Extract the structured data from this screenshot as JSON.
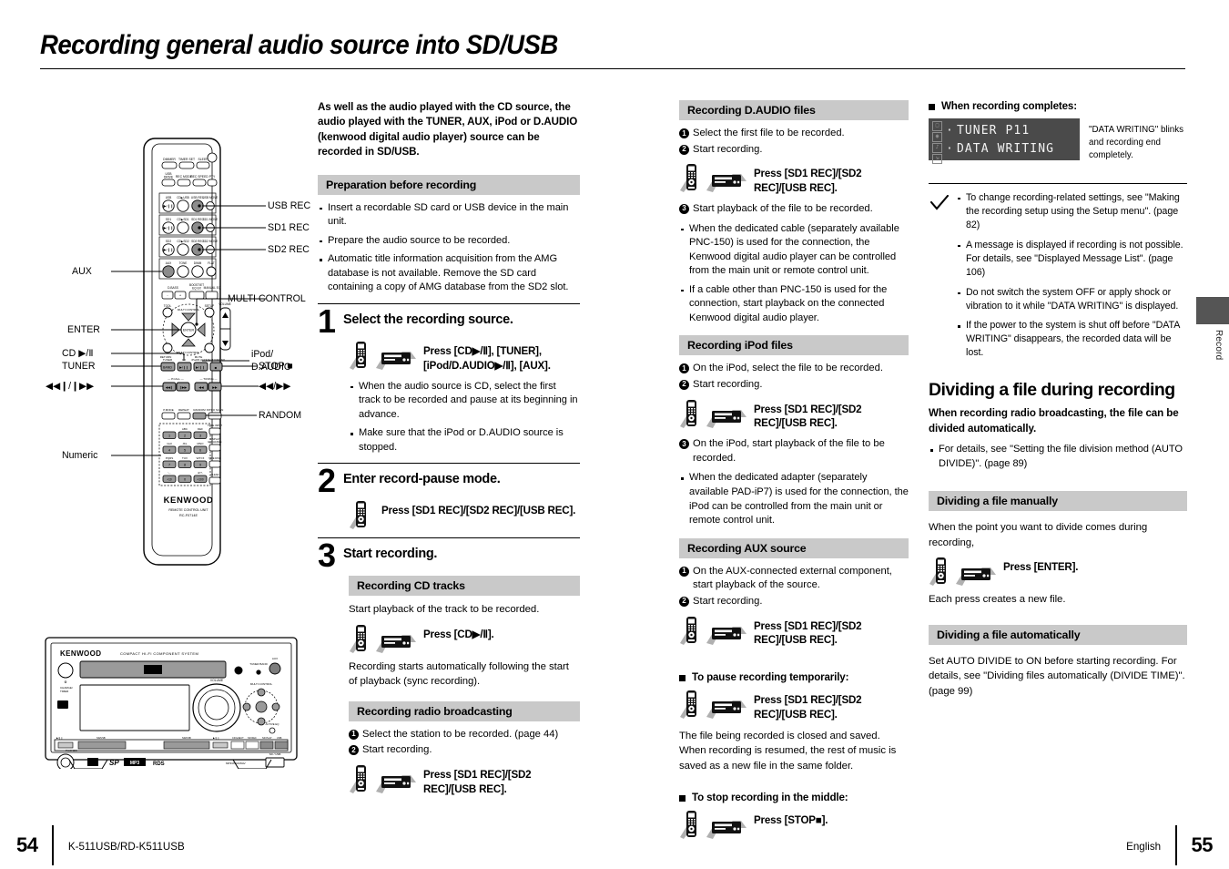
{
  "document": {
    "title": "Recording general audio source into SD/USB",
    "side_tab": "Record",
    "footer": {
      "page_left": "54",
      "model": "K-511USB/RD-K511USB",
      "language": "English",
      "page_right": "55"
    }
  },
  "diagram": {
    "remote_callouts": [
      {
        "label": "USB REC"
      },
      {
        "label": "SD1 REC"
      },
      {
        "label": "SD2 REC"
      },
      {
        "label": "AUX"
      },
      {
        "label": "MULTI CONTROL"
      },
      {
        "label": "ENTER"
      },
      {
        "label": "CD ▶/Ⅱ"
      },
      {
        "label": "TUNER"
      },
      {
        "label": "◀◀/▶▶"
      },
      {
        "label": "iPod/"
      },
      {
        "label": "D.AUDIO"
      },
      {
        "label": "STOP ■"
      },
      {
        "label": "RANDOM"
      },
      {
        "label": "Numeric"
      },
      {
        "label": "◀◀/▶▶"
      }
    ],
    "remote_brand": "KENWOOD",
    "remote_sub1": "REMOTE CONTROL UNIT",
    "remote_sub2": "RC-F0714E",
    "remote_top_row1": [
      "DIMMER",
      "TIMER SET",
      "SLEEP"
    ],
    "remote_top_row2": [
      "USB DRIVE",
      "REC MODE",
      "REC SPEED",
      "PTY"
    ],
    "remote_bank_labels": [
      [
        "USB",
        "CD▶USB",
        "USB REC",
        "USB MOVE"
      ],
      [
        "SD1",
        "CD▶SD1",
        "SD1 REC",
        "SD1 MOVE"
      ],
      [
        "SD2",
        "CD▶SD2",
        "SD2 REC",
        "SD2 MOVE"
      ],
      [
        "AUX",
        "TONE",
        "DIMM",
        "FLAT"
      ]
    ],
    "remote_bass_row": [
      "D-BASS",
      "-",
      "+",
      "BOOST/ET EQ EX",
      "MANUAL EQ"
    ],
    "remote_mid_labels": [
      "TOOL",
      "SETUP",
      "VOLUME",
      "MULTI CONTROL",
      "ENTER"
    ],
    "remote_transport_labels": [
      "RETURN",
      "TUNER",
      "CD",
      "MUTE",
      "iPod/D.AUDIO",
      "AUTO/MONO",
      "P.CALL",
      "TUNING"
    ],
    "remote_mode_labels": [
      "P.MODE",
      "REPEAT",
      "RANDOM",
      "INTRO SCAN"
    ],
    "remote_numeric": [
      "1",
      "2",
      "3",
      "4",
      "5",
      "6",
      "7",
      "8",
      "9",
      "+10",
      "0",
      "+100"
    ],
    "remote_numeric_alpha": [
      "",
      "ABC",
      "DEF",
      "GHI",
      "JKL",
      "MNO",
      "PQRS",
      "TUV",
      "WXYZ",
      "'-,.",
      "",
      "&!?-"
    ],
    "remote_side_labels": [
      "TITLE INPUT",
      "DISPLAY EXCHANGE",
      "TIME DISP.",
      "CLEAR"
    ],
    "unit_brand": "KENWOOD",
    "unit_subtitle": "COMPACT HI-FI COMPONENT SYSTEM",
    "unit_badges": [
      "SD",
      "SP",
      "MP3",
      "RDS"
    ]
  },
  "col2": {
    "lead": "As well as the audio played with the CD source, the audio played with the TUNER, AUX, iPod or D.AUDIO (kenwood digital audio player) source can be recorded in SD/USB.",
    "prep_heading": "Preparation before recording",
    "prep_bullets": [
      "Insert a recordable SD card or USB device in the main unit.",
      "Prepare the audio source to be recorded.",
      "Automatic title information acquisition from the AMG database is not available. Remove the SD card containing a copy of AMG database from the SD2 slot."
    ],
    "step1": {
      "num": "1",
      "title": "Select the recording source.",
      "press": "Press [CD▶/Ⅱ], [TUNER], [iPod/D.AUDIO▶/Ⅱ], [AUX].",
      "bullets": [
        "When the audio source is CD, select the first track to be recorded and pause at its beginning in advance.",
        "Make sure that the iPod or D.AUDIO source is stopped."
      ]
    },
    "step2": {
      "num": "2",
      "title": "Enter record-pause mode.",
      "press": "Press [SD1 REC]/[SD2 REC]/[USB REC]."
    },
    "step3": {
      "num": "3",
      "title": "Start recording.",
      "cd_heading": "Recording CD tracks",
      "cd_intro": "Start playback of the track to be recorded.",
      "cd_press": "Press [CD▶/Ⅱ].",
      "cd_note": "Recording starts automatically following the start of playback (sync recording).",
      "radio_heading": "Recording radio broadcasting",
      "radio_steps": [
        "Select the station to be recorded. (page 44)",
        "Start recording."
      ],
      "radio_press": "Press [SD1 REC]/[SD2 REC]/[USB REC]."
    }
  },
  "col3": {
    "daudio": {
      "heading": "Recording D.AUDIO files",
      "steps_before": [
        "Select the first file to be recorded.",
        "Start recording."
      ],
      "press": "Press [SD1 REC]/[SD2 REC]/[USB REC].",
      "step_after": "Start playback of the file to be recorded.",
      "bullets": [
        "When the dedicated cable (separately available PNC-150) is used for the connection, the Kenwood digital audio player can be controlled from the main unit or remote control unit.",
        "If a cable other than PNC-150 is used for the connection, start playback on the connected Kenwood digital audio player."
      ]
    },
    "ipod": {
      "heading": "Recording iPod files",
      "steps_before": [
        "On the iPod, select the file to be recorded.",
        "Start recording."
      ],
      "press": "Press [SD1 REC]/[SD2 REC]/[USB REC].",
      "step_after": "On the iPod, start playback of the file to be recorded.",
      "bullets": [
        "When the dedicated adapter (separately available PAD-iP7) is used for the connection, the iPod can be controlled from the main unit or remote control unit."
      ]
    },
    "aux": {
      "heading": "Recording AUX source",
      "steps": [
        "On the AUX-connected external component, start playback of the source.",
        "Start recording."
      ],
      "press": "Press [SD1 REC]/[SD2 REC]/[USB REC]."
    },
    "pause": {
      "heading": "To pause recording temporarily:",
      "press": "Press [SD1 REC]/[SD2 REC]/[USB REC].",
      "note": "The file being recorded is closed and saved. When recording is resumed, the rest of music is saved as a new file in the same folder."
    },
    "stop": {
      "heading": "To stop recording in the middle:",
      "press": "Press [STOP■]."
    }
  },
  "col4": {
    "complete": {
      "heading": "When recording completes:",
      "lcd_line1": "TUNER P11",
      "lcd_line2": "DATA WRITING",
      "note": "\"DATA WRITING\" blinks and recording end completely."
    },
    "notes": [
      "To change recording-related settings, see \"Making the recording setup using the Setup menu\". (page 82)",
      "A message is displayed if recording is not possible. For details, see \"Displayed Message List\". (page 106)",
      "Do not switch the system OFF or apply shock or vibration to it while \"DATA WRITING\" is displayed.",
      "If the power to the system is shut off before \"DATA WRITING\" disappears, the recorded data will be lost."
    ],
    "divide": {
      "heading": "Dividing a file during recording",
      "lead": "When recording radio broadcasting, the file can be divided automatically.",
      "bullets": [
        "For details, see \"Setting the file division method (AUTO DIVIDE)\". (page 89)"
      ],
      "manual_heading": "Dividing a file manually",
      "manual_intro": "When the point you want to divide comes during recording,",
      "manual_press": "Press [ENTER].",
      "manual_note": "Each press creates a new file.",
      "auto_heading": "Dividing a file automatically",
      "auto_note": "Set AUTO DIVIDE to ON before starting recording. For details, see \"Dividing files automatically (DIVIDE TIME)\". (page 99)"
    }
  },
  "colors": {
    "section_bar": "#c9c9c9",
    "lcd_bg": "#4a4a4a",
    "lcd_text": "#f2f2f2",
    "tab": "#555555"
  }
}
